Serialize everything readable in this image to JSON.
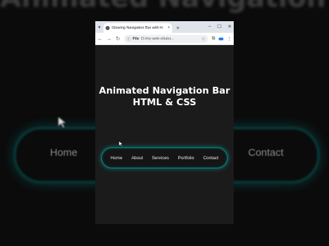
{
  "background": {
    "title": "Animated Navigation Bar",
    "nav_left": "Home",
    "nav_right": "Contact"
  },
  "browser": {
    "tab_title": "Glowing Navigation Bar with H",
    "tab_close": "×",
    "new_tab": "+",
    "window_controls": [
      "–",
      "☐",
      "✕"
    ],
    "address_chip": "File",
    "address_url": "D:/my-web-x/tutor..."
  },
  "page": {
    "heading_line1": "Animated Navigation Bar",
    "heading_line2": "HTML & CSS",
    "nav_items": [
      "Home",
      "About",
      "Services",
      "Portfolio",
      "Contact"
    ]
  },
  "colors": {
    "glow": "#00b4aa",
    "page_bg": "#1b1b1b"
  }
}
